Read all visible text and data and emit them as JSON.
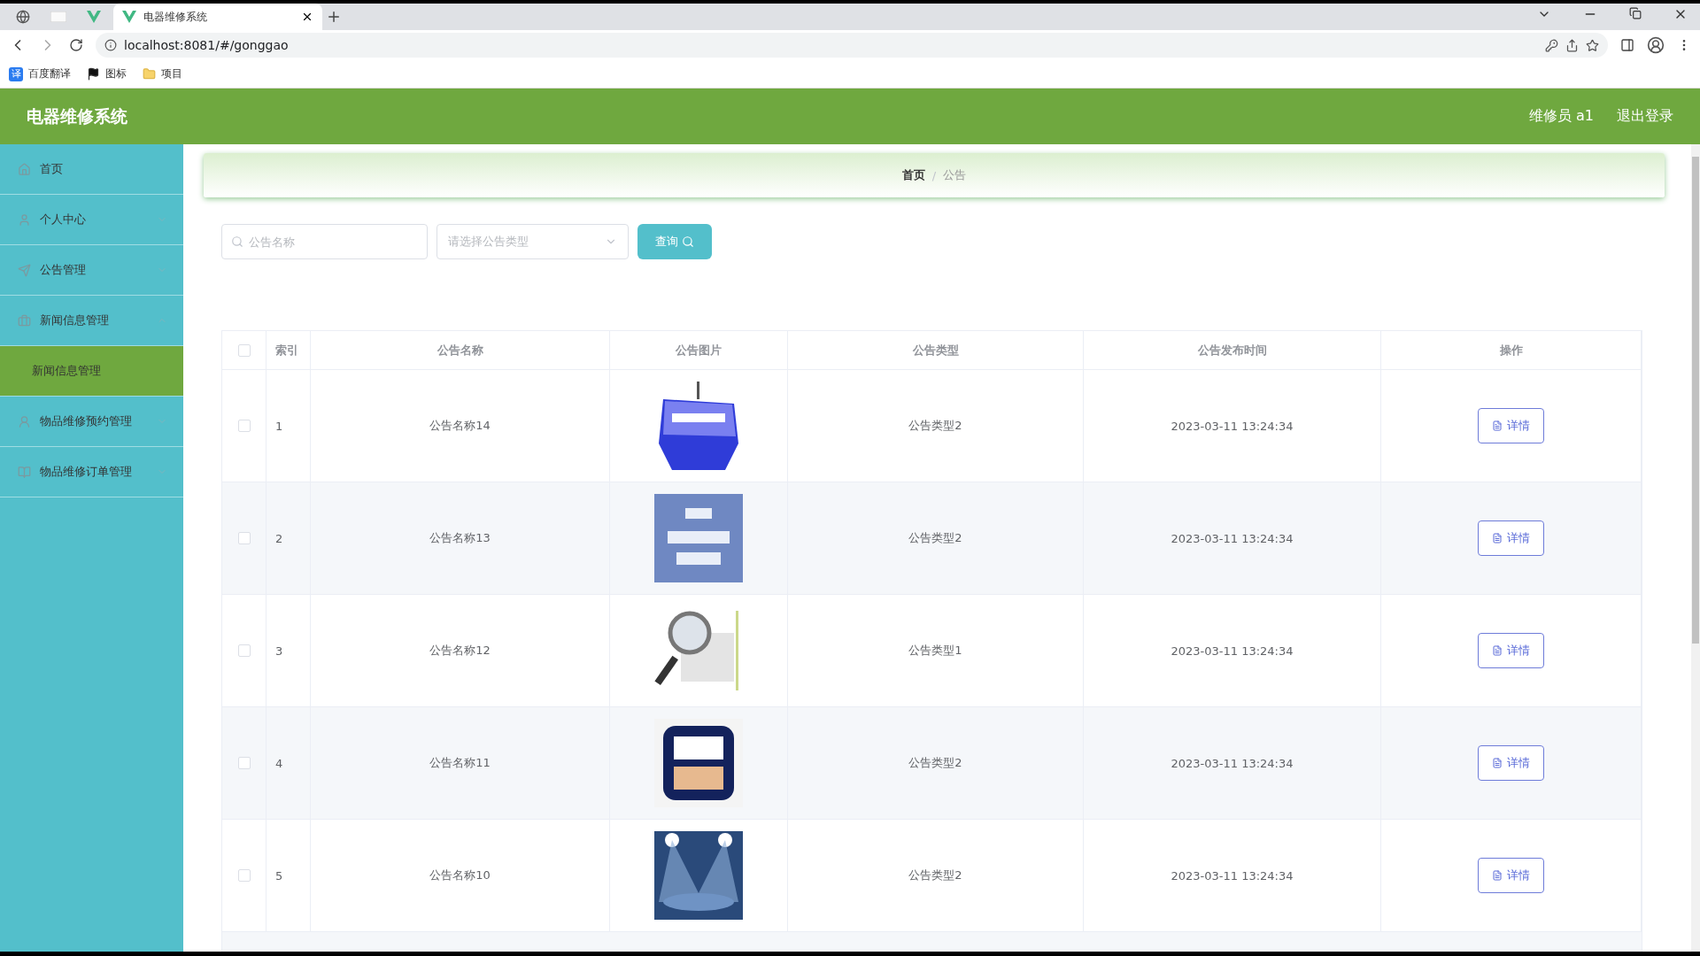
{
  "browser": {
    "tab_title": "电器维修系统",
    "address": "localhost:8081/#/gonggao",
    "bookmarks": [
      {
        "badge": "译",
        "label": "百度翻译"
      },
      {
        "label": "图标"
      },
      {
        "label": "项目"
      }
    ]
  },
  "header": {
    "title": "电器维修系统",
    "user": "维修员 a1",
    "logout": "退出登录"
  },
  "sidebar": {
    "items": [
      {
        "label": "首页"
      },
      {
        "label": "个人中心",
        "expandable": true,
        "expanded": false
      },
      {
        "label": "公告管理",
        "expandable": true,
        "expanded": false
      },
      {
        "label": "新闻信息管理",
        "expandable": true,
        "expanded": true,
        "children": [
          {
            "label": "新闻信息管理",
            "selected": true
          }
        ]
      },
      {
        "label": "物品维修预约管理",
        "expandable": true,
        "expanded": false
      },
      {
        "label": "物品维修订单管理",
        "expandable": true,
        "expanded": false
      }
    ]
  },
  "breadcrumb": {
    "items": [
      "首页",
      "公告"
    ],
    "separator": "/"
  },
  "search": {
    "name_placeholder": "公告名称",
    "type_placeholder": "请选择公告类型",
    "button": "查询"
  },
  "table": {
    "all_checked": false,
    "columns": [
      "索引",
      "公告名称",
      "公告图片",
      "公告类型",
      "公告发布时间",
      "操作"
    ],
    "rows": [
      {
        "checked": false,
        "index": "1",
        "name": "公告名称14",
        "type": "公告类型2",
        "time": "2023-03-11 13:24:34",
        "action": "详情"
      },
      {
        "checked": false,
        "index": "2",
        "name": "公告名称13",
        "type": "公告类型2",
        "time": "2023-03-11 13:24:34",
        "action": "详情"
      },
      {
        "checked": false,
        "index": "3",
        "name": "公告名称12",
        "type": "公告类型1",
        "time": "2023-03-11 13:24:34",
        "action": "详情"
      },
      {
        "checked": false,
        "index": "4",
        "name": "公告名称11",
        "type": "公告类型2",
        "time": "2023-03-11 13:24:34",
        "action": "详情"
      },
      {
        "checked": false,
        "index": "5",
        "name": "公告名称10",
        "type": "公告类型2",
        "time": "2023-03-11 13:24:34",
        "action": "详情"
      }
    ]
  }
}
